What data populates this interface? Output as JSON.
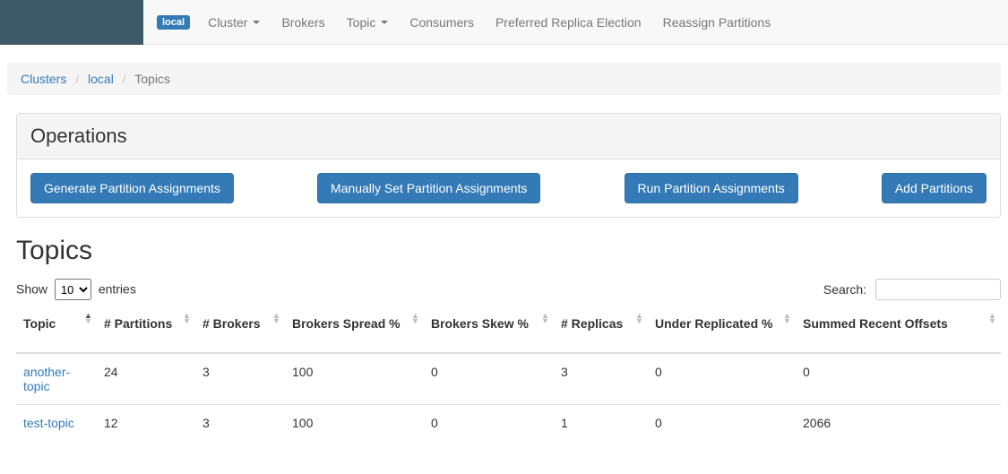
{
  "nav": {
    "badge": "local",
    "items": [
      {
        "label": "Cluster",
        "caret": true
      },
      {
        "label": "Brokers",
        "caret": false
      },
      {
        "label": "Topic",
        "caret": true
      },
      {
        "label": "Consumers",
        "caret": false
      },
      {
        "label": "Preferred Replica Election",
        "caret": false
      },
      {
        "label": "Reassign Partitions",
        "caret": false
      }
    ]
  },
  "breadcrumb": {
    "clusters": "Clusters",
    "cluster_name": "local",
    "current": "Topics"
  },
  "operations": {
    "heading": "Operations",
    "buttons": {
      "generate": "Generate Partition Assignments",
      "manual": "Manually Set Partition Assignments",
      "run": "Run Partition Assignments",
      "add": "Add Partitions"
    }
  },
  "topics_panel": {
    "heading": "Topics",
    "show_prefix": "Show",
    "show_suffix": "entries",
    "show_value": "10",
    "search_label": "Search:",
    "columns": {
      "topic": "Topic",
      "partitions": "# Partitions",
      "brokers": "# Brokers",
      "spread": "Brokers Spread %",
      "skew": "Brokers Skew %",
      "replicas": "# Replicas",
      "under": "Under Replicated %",
      "offsets": "Summed Recent Offsets"
    },
    "rows": [
      {
        "topic": "another-topic",
        "partitions": "24",
        "brokers": "3",
        "spread": "100",
        "skew": "0",
        "replicas": "3",
        "under": "0",
        "offsets": "0"
      },
      {
        "topic": "test-topic",
        "partitions": "12",
        "brokers": "3",
        "spread": "100",
        "skew": "0",
        "replicas": "1",
        "under": "0",
        "offsets": "2066"
      }
    ]
  }
}
